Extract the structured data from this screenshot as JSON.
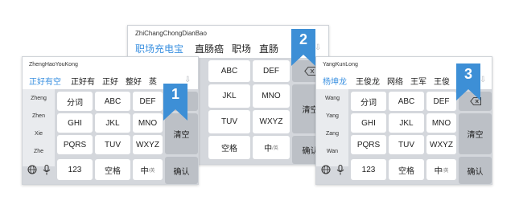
{
  "panels": {
    "left": {
      "pinyin": "ZhengHaoYouKong",
      "candidates": [
        "正好有空",
        "正好有",
        "正好",
        "整好",
        "蒸"
      ],
      "syllables": [
        "Zheng",
        "Zhen",
        "Xie",
        "Zhe"
      ],
      "keys": [
        "分词",
        "ABC",
        "DEF",
        "GHI",
        "JKL",
        "MNO",
        "PQRS",
        "TUV",
        "WXYZ",
        "123",
        "空格",
        "中"
      ],
      "key_sub": "/英",
      "clear": "清空",
      "confirm": "确认",
      "badge": "1"
    },
    "middle": {
      "pinyin": "ZhiChangChongDianBao",
      "candidates": [
        "职场充电宝",
        "直肠癌",
        "职场",
        "直肠"
      ],
      "keys": [
        "ABC",
        "DEF",
        "JKL",
        "MNO",
        "TUV",
        "WXYZ",
        "空格",
        "中"
      ],
      "key_sub": "/英",
      "clear": "清空",
      "confirm": "确认",
      "badge": "2"
    },
    "right": {
      "pinyin": "YangKunLong",
      "candidates": [
        "杨坤龙",
        "王俊龙",
        "网络",
        "王军",
        "王俊"
      ],
      "syllables": [
        "Wang",
        "Yang",
        "Zang",
        "Wan"
      ],
      "keys": [
        "分词",
        "ABC",
        "DEF",
        "GHI",
        "JKL",
        "MNO",
        "PQRS",
        "TUV",
        "WXYZ",
        "123",
        "空格",
        "中"
      ],
      "key_sub": "/英",
      "clear": "清空",
      "confirm": "确认",
      "badge": "3"
    }
  },
  "colors": {
    "highlight": "#3a90e0",
    "badge": "#3d8fd6",
    "key": "#ffffff",
    "key_function": "#bcc0c6",
    "keyboard_bg": "#d4d7dc"
  }
}
